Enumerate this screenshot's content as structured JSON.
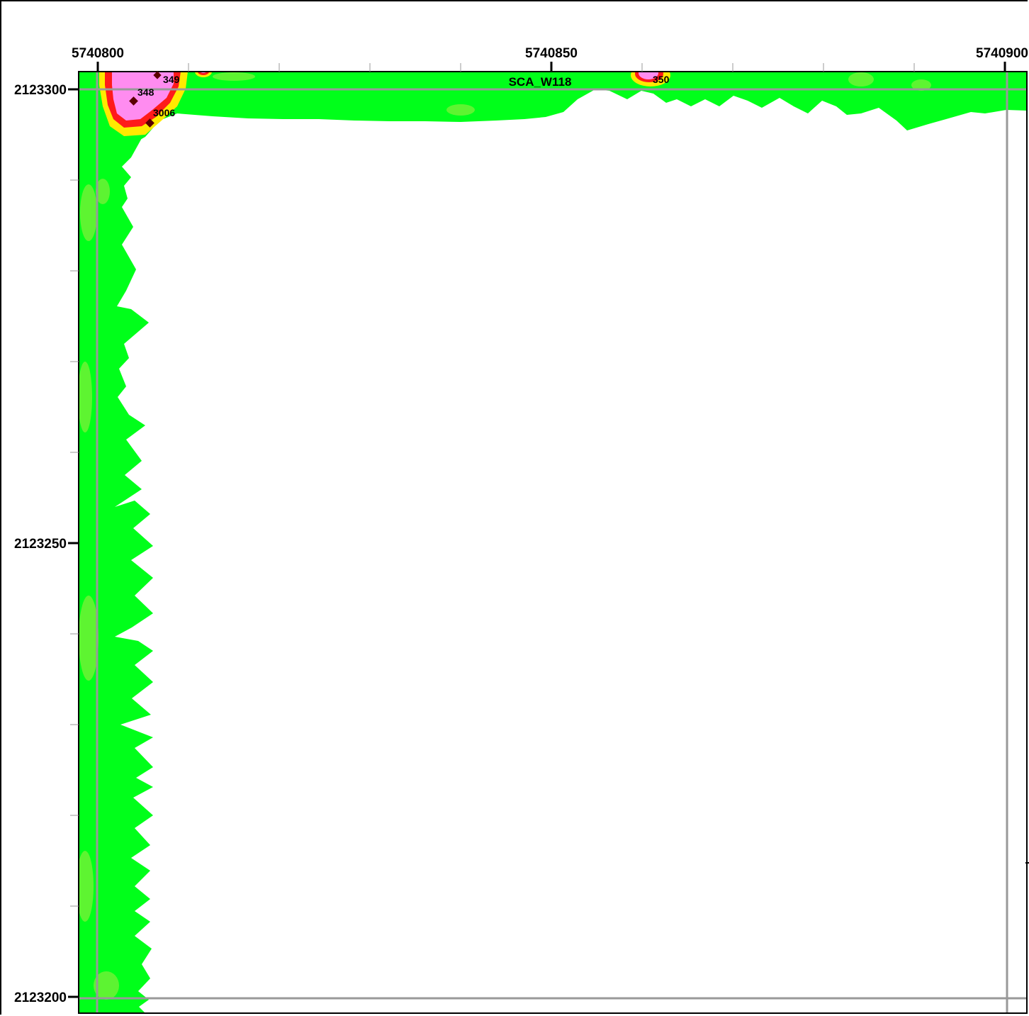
{
  "map": {
    "x_axis": {
      "ticks": [
        {
          "value": 5740800,
          "label": "5740800"
        },
        {
          "value": 5740850,
          "label": "5740850"
        },
        {
          "value": 5740900,
          "label": "5740900"
        }
      ]
    },
    "y_axis": {
      "ticks": [
        {
          "value": 2123300,
          "label": "2123300"
        },
        {
          "value": 2123250,
          "label": "2123250"
        },
        {
          "value": 2123200,
          "label": "2123200"
        }
      ]
    },
    "sheet_label": "SCA_W118",
    "sample_points": [
      {
        "id": "349",
        "label": "349"
      },
      {
        "id": "348",
        "label": "348"
      },
      {
        "id": "3006",
        "label": "3006"
      },
      {
        "id": "350",
        "label": "350"
      }
    ],
    "colors": {
      "coverage": "#00ff1a",
      "coverage_light": "#7df03a",
      "high_value": "#ff8cf0",
      "ring_red": "#ff1a1a",
      "ring_yellow": "#ffea00",
      "boundary": "#999999",
      "frame": "#000000",
      "point_marker": "#5a0000"
    }
  }
}
